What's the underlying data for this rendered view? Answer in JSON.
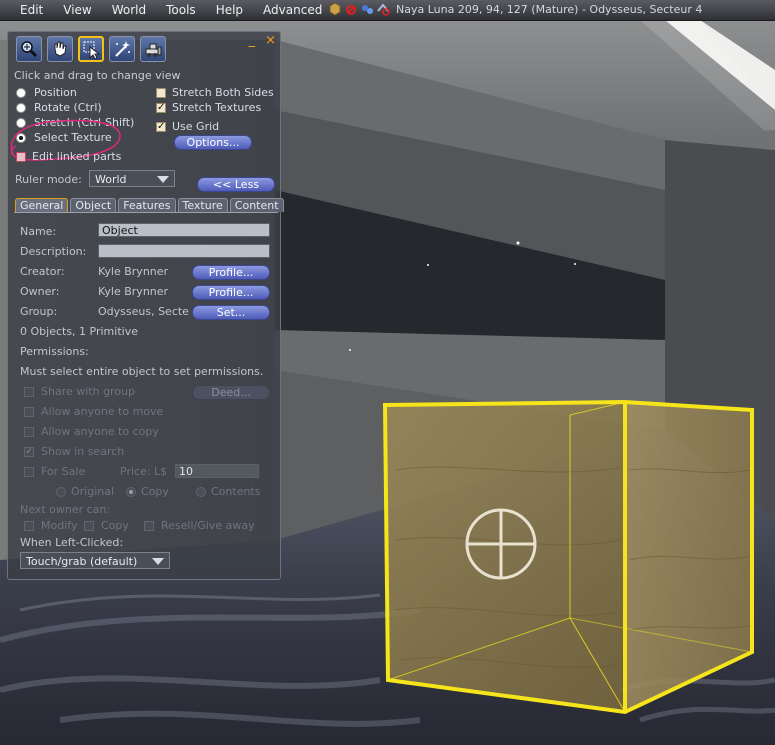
{
  "menu": {
    "items": [
      "Edit",
      "View",
      "World",
      "Tools",
      "Help",
      "Advanced"
    ]
  },
  "status": {
    "location": "Naya Luna 209, 94, 127 (Mature) - Odysseus, Secteur 4",
    "icons": [
      "cube-icon",
      "no-build-icon",
      "scripts-icon",
      "no-fly-icon"
    ]
  },
  "floater": {
    "controls": [
      "_",
      "×"
    ],
    "tools": [
      {
        "name": "focus-tool-icon",
        "selected": false
      },
      {
        "name": "grab-tool-icon",
        "selected": false
      },
      {
        "name": "edit-tool-icon",
        "selected": true
      },
      {
        "name": "create-tool-icon",
        "selected": false
      },
      {
        "name": "land-tool-icon",
        "selected": false
      }
    ],
    "hint": "Click and drag to change view",
    "modes": [
      "Position",
      "Rotate (Ctrl)",
      "Stretch (Ctrl-Shift)",
      "Select Texture"
    ],
    "selected_mode": "Select Texture",
    "edit_linked": "Edit linked parts",
    "stretch_both": "Stretch Both Sides",
    "stretch_textures": "Stretch Textures",
    "use_grid": "Use Grid",
    "stretch_both_checked": false,
    "stretch_textures_checked": true,
    "use_grid_checked": true,
    "options_button": "Options...",
    "ruler_label": "Ruler mode:",
    "ruler_value": "World",
    "less_button": "<< Less",
    "tabs": [
      "General",
      "Object",
      "Features",
      "Texture",
      "Content"
    ],
    "active_tab": "General"
  },
  "general": {
    "name_label": "Name:",
    "name_value": "Object",
    "description_label": "Description:",
    "description_value": "",
    "creator_label": "Creator:",
    "creator_value": "Kyle Brynner",
    "owner_label": "Owner:",
    "owner_value": "Kyle Brynner",
    "group_label": "Group:",
    "group_value": "Odysseus, Secte",
    "profile_button": "Profile...",
    "set_button": "Set...",
    "counts": "0 Objects, 1 Primitive",
    "permissions_label": "Permissions:",
    "permissions_note": "Must select entire object to set permissions.",
    "share_with_group": "Share with group",
    "deed_button": "Deed...",
    "allow_move": "Allow anyone to move",
    "allow_copy": "Allow anyone to copy",
    "show_in_search": "Show in search",
    "for_sale": "For Sale",
    "price_label": "Price: L$",
    "price_value": "10",
    "sale_types": [
      "Original",
      "Copy",
      "Contents"
    ],
    "next_owner_label": "Next owner can:",
    "next_owner_options": [
      "Modify",
      "Copy",
      "Resell/Give away"
    ],
    "when_clicked_label": "When Left-Clicked:",
    "click_action": "Touch/grab (default)"
  },
  "colors": {
    "selection_highlight": "#f5e51a",
    "accent": "#f0a020",
    "annotation": "#e0287e"
  }
}
